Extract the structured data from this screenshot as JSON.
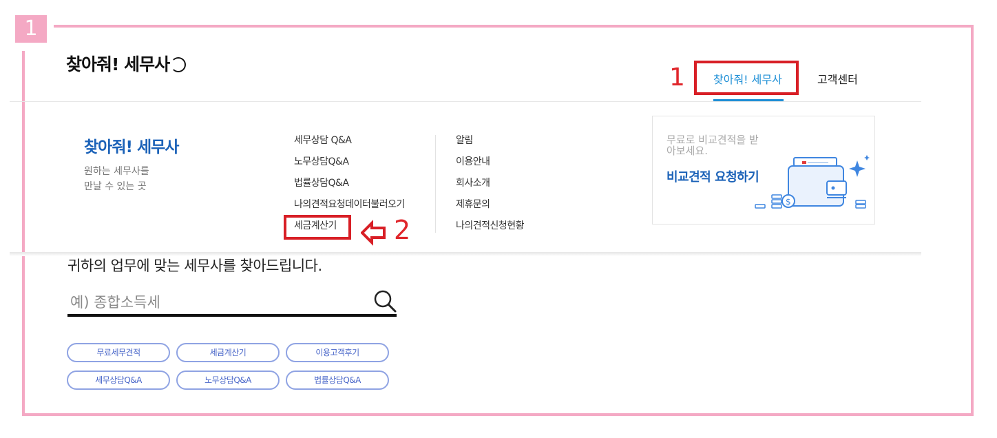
{
  "annotation": {
    "step_badge": "1",
    "nav_number": "1",
    "menu_number": "2"
  },
  "header": {
    "logo": "찾아줘! 세무사",
    "nav": [
      {
        "label": "찾아줘! 세무사",
        "active": true
      },
      {
        "label": "고객센터",
        "active": false
      }
    ]
  },
  "mega_menu": {
    "title": "찾아줘! 세무사",
    "desc_line1": "원하는 세무사를",
    "desc_line2": "만날 수 있는 곳",
    "col1": [
      "세무상담 Q&A",
      "노무상담Q&A",
      "법률상담Q&A",
      "나의견적요청데이터불러오기",
      "세금계산기"
    ],
    "col2": [
      "알림",
      "이용안내",
      "회사소개",
      "제휴문의",
      "나의견적신청현황"
    ],
    "banner": {
      "subtitle": "무료로 비교견적을 받아보세요.",
      "cta": "비교견적 요청하기"
    }
  },
  "search": {
    "heading": "귀하의 업무에 맞는 세무사를 찾아드립니다.",
    "placeholder": "예) 종합소득세",
    "quick_links": [
      "무료세무견적",
      "세금계산기",
      "이용고객후기",
      "세무상담Q&A",
      "노무상담Q&A",
      "법률상담Q&A"
    ]
  },
  "colors": {
    "brand_blue": "#1b62b8",
    "nav_active": "#1e8fd6",
    "annotation_red": "#d81f26",
    "frame_pink": "#f4a9c4",
    "pill_border": "#8fa3e3"
  }
}
